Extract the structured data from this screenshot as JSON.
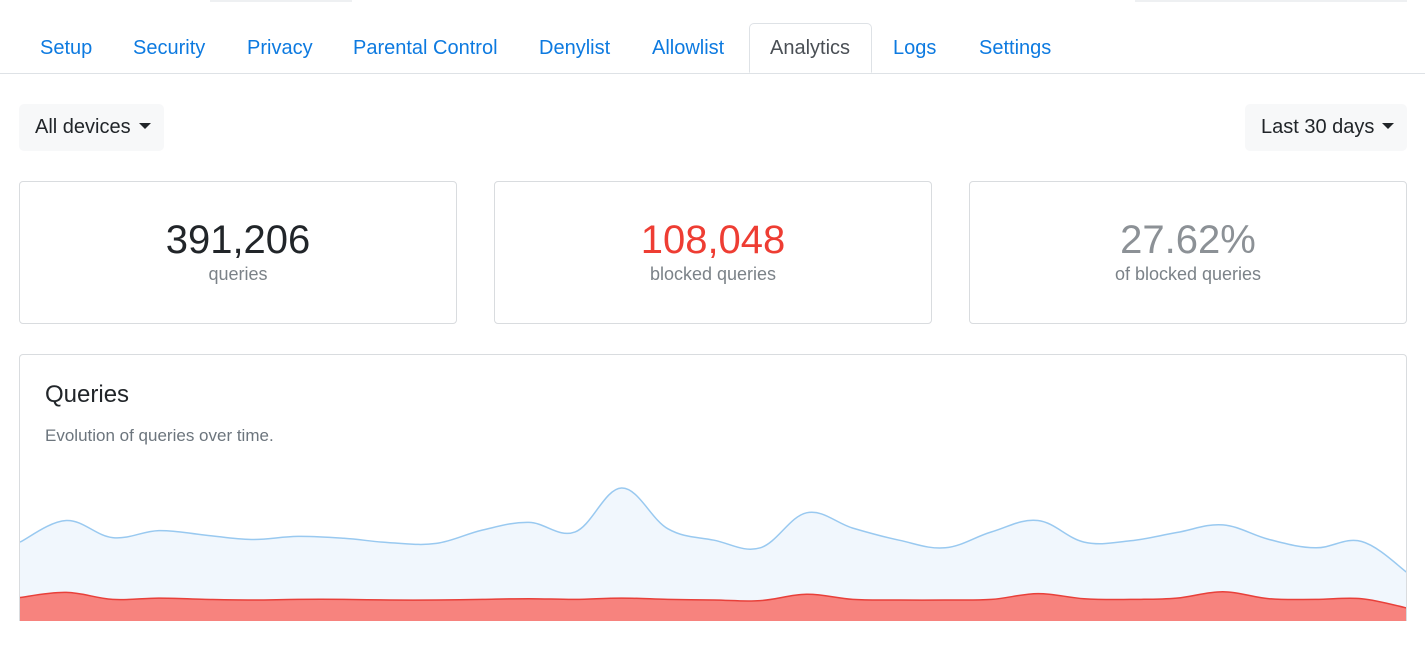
{
  "tabs": [
    {
      "label": "Setup",
      "active": false
    },
    {
      "label": "Security",
      "active": false
    },
    {
      "label": "Privacy",
      "active": false
    },
    {
      "label": "Parental Control",
      "active": false
    },
    {
      "label": "Denylist",
      "active": false
    },
    {
      "label": "Allowlist",
      "active": false
    },
    {
      "label": "Analytics",
      "active": true
    },
    {
      "label": "Logs",
      "active": false
    },
    {
      "label": "Settings",
      "active": false
    }
  ],
  "filters": {
    "device": "All devices",
    "range": "Last 30 days"
  },
  "stats": [
    {
      "value": "391,206",
      "label": "queries",
      "color": "#212529"
    },
    {
      "value": "108,048",
      "label": "blocked queries",
      "color": "#ee3d33"
    },
    {
      "value": "27.62%",
      "label": "of blocked queries",
      "color": "#8c9196"
    }
  ],
  "queries_chart": {
    "title": "Queries",
    "subtitle": "Evolution of queries over time."
  },
  "colors": {
    "link": "#0d7ae0",
    "queries_line": "#99c9f0",
    "queries_fill": "#f1f7fd",
    "blocked_line": "#e8403a",
    "blocked_fill": "#f7837e"
  },
  "chart_data": {
    "type": "area",
    "title": "Queries",
    "subtitle": "Evolution of queries over time.",
    "xlabel": "",
    "ylabel": "",
    "grid": false,
    "x": [
      1,
      2,
      3,
      4,
      5,
      6,
      7,
      8,
      9,
      10,
      11,
      12,
      13,
      14,
      15,
      16,
      17,
      18,
      19,
      20,
      21,
      22,
      23,
      24,
      25,
      26,
      27,
      28,
      29,
      30,
      31
    ],
    "series": [
      {
        "values": [
          12400,
          15800,
          13100,
          14200,
          13500,
          12800,
          13300,
          13000,
          12300,
          12200,
          14300,
          15500,
          14000,
          20900,
          14500,
          12700,
          11500,
          17000,
          14600,
          12700,
          11500,
          14000,
          15800,
          12400,
          12600,
          13900,
          15100,
          12800,
          11500,
          12500,
          7500
        ]
      },
      {
        "values": [
          3700,
          4500,
          3400,
          3600,
          3400,
          3300,
          3400,
          3400,
          3300,
          3300,
          3400,
          3500,
          3400,
          3600,
          3400,
          3300,
          3200,
          4200,
          3400,
          3300,
          3300,
          3400,
          4300,
          3500,
          3400,
          3600,
          4600,
          3500,
          3400,
          3500,
          2000
        ]
      }
    ]
  }
}
